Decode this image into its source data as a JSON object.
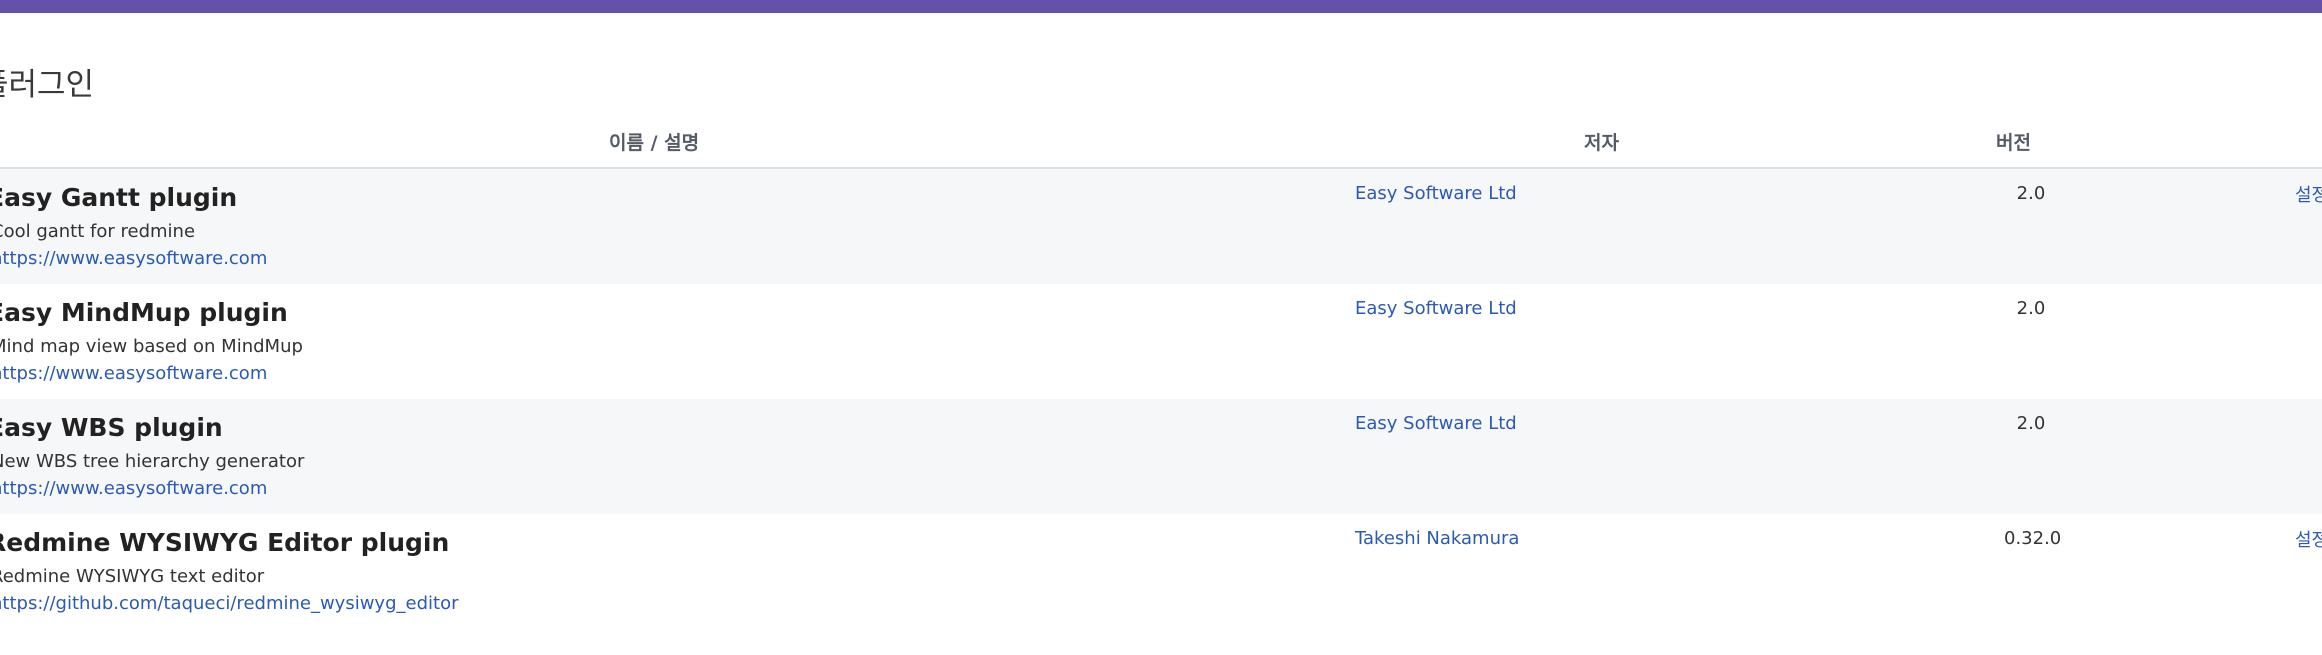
{
  "header": {
    "page_title": "플러그인"
  },
  "table": {
    "columns": {
      "name": "이름 / 설명",
      "author": "저자",
      "version": "버전"
    },
    "rows": [
      {
        "name": "Easy Gantt plugin",
        "description": "Cool gantt for redmine",
        "url": "https://www.easysoftware.com",
        "author": "Easy Software Ltd",
        "version": "2.0",
        "configure": "설정"
      },
      {
        "name": "Easy MindMup plugin",
        "description": "Mind map view based on MindMup",
        "url": "https://www.easysoftware.com",
        "author": "Easy Software Ltd",
        "version": "2.0",
        "configure": ""
      },
      {
        "name": "Easy WBS plugin",
        "description": "New WBS tree hierarchy generator",
        "url": "https://www.easysoftware.com",
        "author": "Easy Software Ltd",
        "version": "2.0",
        "configure": ""
      },
      {
        "name": "Redmine WYSIWYG Editor plugin",
        "description": "Redmine WYSIWYG text editor",
        "url": "https://github.com/taqueci/redmine_wysiwyg_editor",
        "author": "Takeshi Nakamura",
        "version": "0.32.0",
        "configure": "설정"
      }
    ]
  },
  "colors": {
    "topbar": "#6651a9",
    "link": "#2a5ab4",
    "row_alt": "#f6f7f9"
  }
}
